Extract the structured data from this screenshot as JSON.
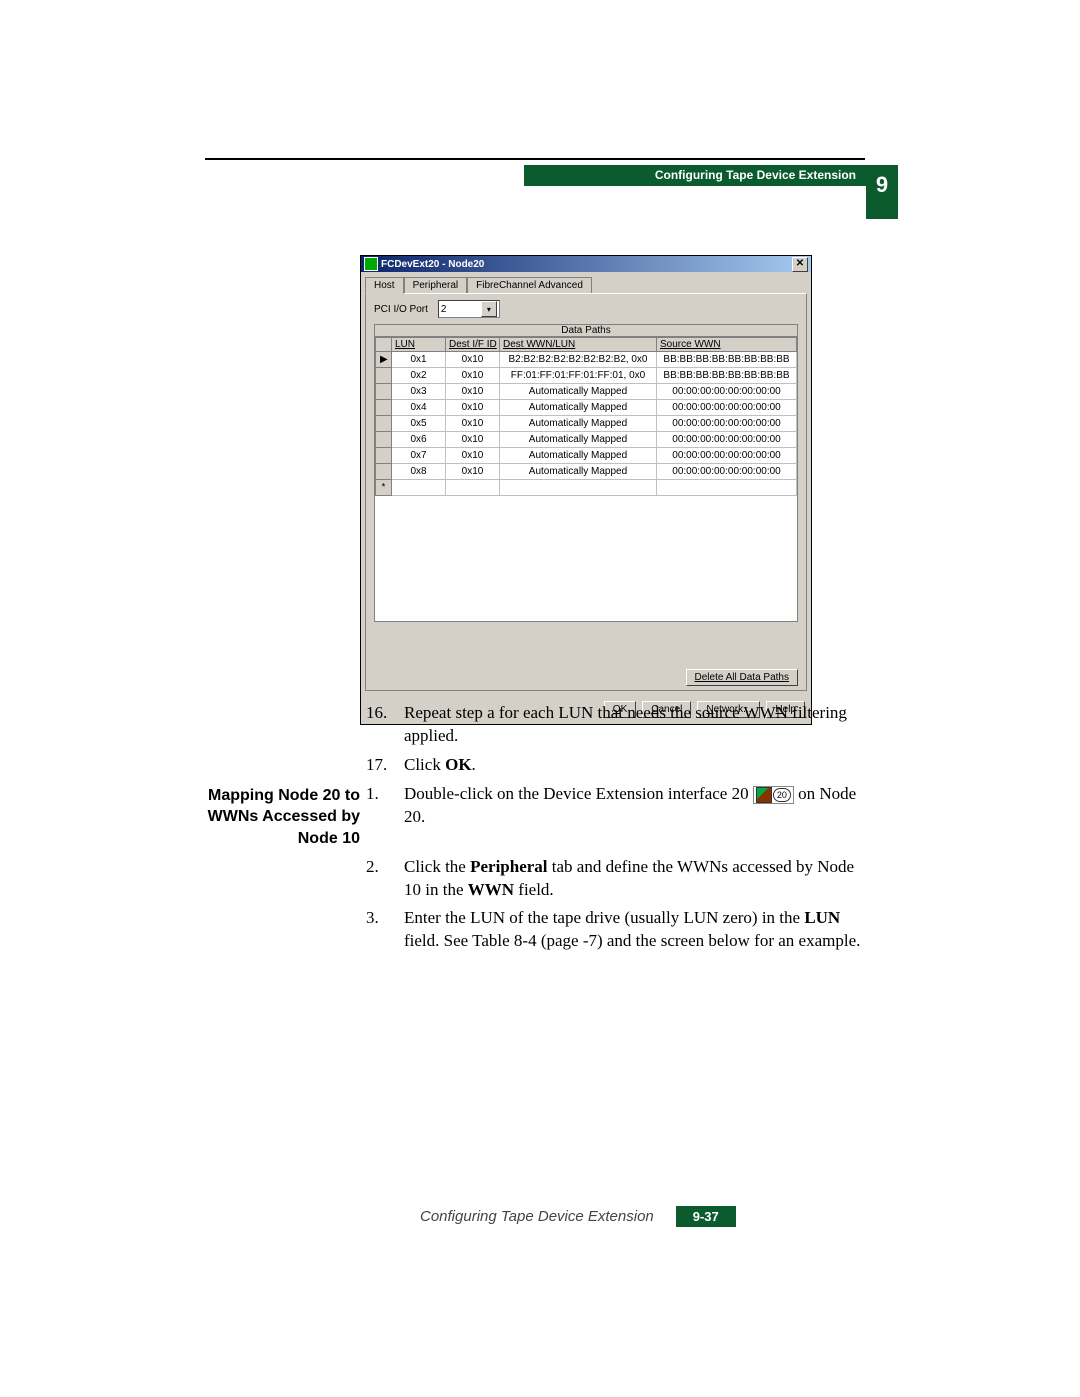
{
  "header": {
    "title": "Configuring Tape Device Extension",
    "chapter": "9"
  },
  "dialog": {
    "title": "FCDevExt20 - Node20",
    "close": "✕",
    "tabs": [
      "Host",
      "Peripheral",
      "FibreChannel Advanced"
    ],
    "pci_label": "PCI I/O Port",
    "pci_value": "2",
    "table_caption": "Data Paths",
    "columns": [
      "LUN",
      "Dest I/F ID",
      "Dest WWN/LUN",
      "Source WWN"
    ],
    "rows": [
      {
        "marker": "▶",
        "lun": "0x1",
        "dest": "0x10",
        "wwn": "B2:B2:B2:B2:B2:B2:B2:B2, 0x0",
        "src": "BB:BB:BB:BB:BB:BB:BB:BB"
      },
      {
        "marker": "",
        "lun": "0x2",
        "dest": "0x10",
        "wwn": "FF:01:FF:01:FF:01:FF:01, 0x0",
        "src": "BB:BB:BB:BB:BB:BB:BB:BB"
      },
      {
        "marker": "",
        "lun": "0x3",
        "dest": "0x10",
        "wwn": "Automatically Mapped",
        "src": "00:00:00:00:00:00:00:00"
      },
      {
        "marker": "",
        "lun": "0x4",
        "dest": "0x10",
        "wwn": "Automatically Mapped",
        "src": "00:00:00:00:00:00:00:00"
      },
      {
        "marker": "",
        "lun": "0x5",
        "dest": "0x10",
        "wwn": "Automatically Mapped",
        "src": "00:00:00:00:00:00:00:00"
      },
      {
        "marker": "",
        "lun": "0x6",
        "dest": "0x10",
        "wwn": "Automatically Mapped",
        "src": "00:00:00:00:00:00:00:00"
      },
      {
        "marker": "",
        "lun": "0x7",
        "dest": "0x10",
        "wwn": "Automatically Mapped",
        "src": "00:00:00:00:00:00:00:00"
      },
      {
        "marker": "",
        "lun": "0x8",
        "dest": "0x10",
        "wwn": "Automatically Mapped",
        "src": "00:00:00:00:00:00:00:00"
      }
    ],
    "new_row_marker": "*",
    "delete_all": "Delete All Data Paths",
    "buttons": {
      "ok": "OK",
      "cancel": "Cancel",
      "network": "Network...",
      "help": "Help"
    }
  },
  "steps": {
    "s16": "Repeat step a for each LUN that needs the source WWN filtering applied.",
    "s17_pre": "Click ",
    "s17_bold": "OK",
    "s17_post": ".",
    "section_label_l1": "Mapping Node 20 to",
    "section_label_l2": "WWNs Accessed by",
    "section_label_l3": "Node 10",
    "s1_pre": "Double-click on the Device Extension interface 20 ",
    "icon_num": "20",
    "s1_post": " on Node 20.",
    "s2_pre": "Click the ",
    "s2_b1": "Peripheral",
    "s2_mid": " tab and define the WWNs accessed by Node 10 in the ",
    "s2_b2": "WWN",
    "s2_post": " field.",
    "s3_pre": "Enter the LUN of the tape drive (usually LUN zero) in the ",
    "s3_b1": "LUN",
    "s3_post": " field. See Table 8-4 (page -7) and the screen below for an example."
  },
  "footer": {
    "text": "Configuring Tape Device Extension",
    "page": "9-37"
  }
}
